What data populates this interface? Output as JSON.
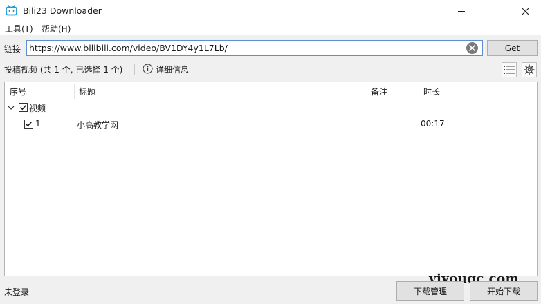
{
  "window": {
    "title": "Bili23 Downloader",
    "accent": "#1e9ad6"
  },
  "menu": {
    "items": [
      {
        "label": "工具(T)"
      },
      {
        "label": "帮助(H)"
      }
    ]
  },
  "url_bar": {
    "label": "链接",
    "value": "https://www.bilibili.com/video/BV1DY4y1L7Lb/",
    "get_label": "Get"
  },
  "info_bar": {
    "summary": "投稿视频 (共 1 个, 已选择 1 个)",
    "detail_label": "详细信息"
  },
  "list": {
    "columns": [
      "序号",
      "标题",
      "备注",
      "时长"
    ],
    "group": {
      "label": "视频",
      "checked": true,
      "expanded": true
    },
    "rows": [
      {
        "index": "1",
        "title": "小高教学网",
        "note": "",
        "duration": "00:17",
        "checked": true
      }
    ]
  },
  "footer": {
    "status": "未登录",
    "download_manager_label": "下载管理",
    "start_download_label": "开始下载"
  },
  "watermark": "yiyouqc.com",
  "icons": {
    "app": "bilibili-tv-icon",
    "clear": "clear-circle-icon",
    "info": "info-circle-icon",
    "list_view": "list-icon",
    "settings": "gear-icon"
  }
}
